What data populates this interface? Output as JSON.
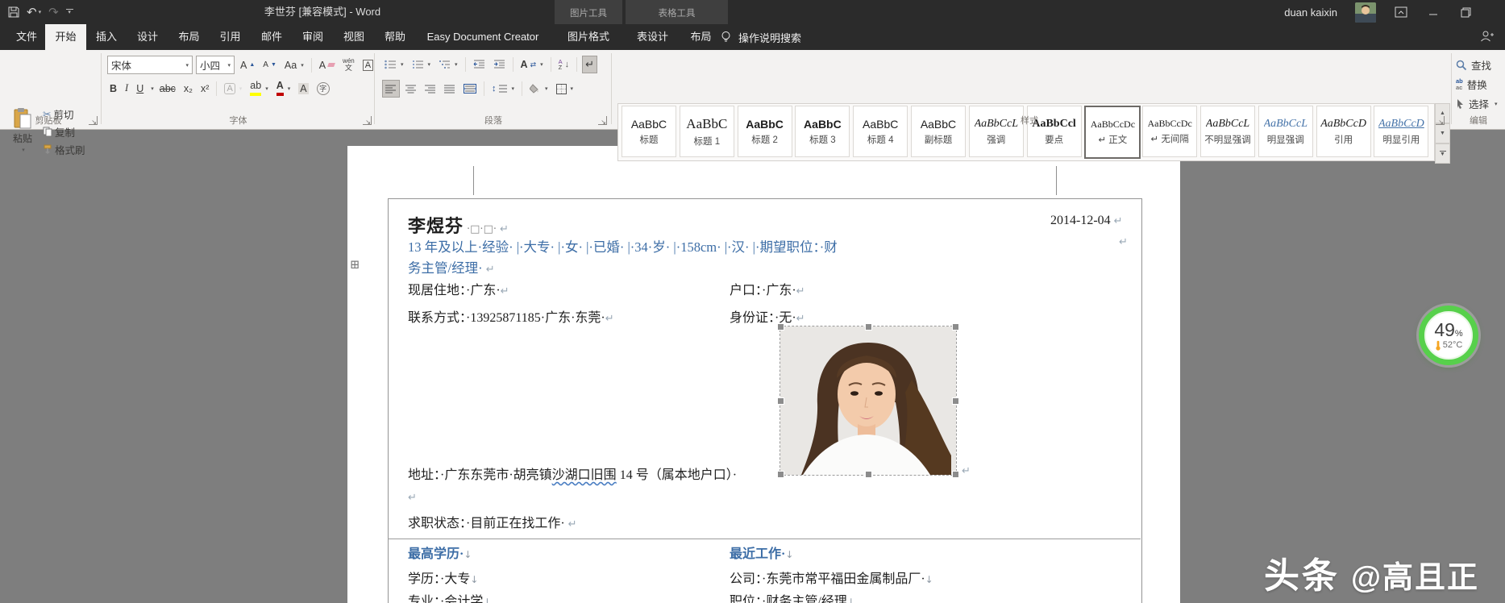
{
  "title_bar": {
    "title": "李世芬 [兼容模式]  -  Word",
    "user_name": "duan kaixin",
    "contextual_groups": [
      {
        "label": "图片工具"
      },
      {
        "label": "表格工具"
      }
    ]
  },
  "tabs": {
    "items": [
      {
        "id": "file",
        "label": "文件"
      },
      {
        "id": "home",
        "label": "开始",
        "active": true
      },
      {
        "id": "insert",
        "label": "插入"
      },
      {
        "id": "design",
        "label": "设计"
      },
      {
        "id": "layout",
        "label": "布局"
      },
      {
        "id": "references",
        "label": "引用"
      },
      {
        "id": "mailings",
        "label": "邮件"
      },
      {
        "id": "review",
        "label": "审阅"
      },
      {
        "id": "view",
        "label": "视图"
      },
      {
        "id": "help",
        "label": "帮助"
      },
      {
        "id": "easy-document-creator",
        "label": "Easy Document Creator"
      },
      {
        "id": "picture-format",
        "label": "图片格式",
        "contextual": true
      },
      {
        "id": "table-design",
        "label": "表设计",
        "contextual": true
      },
      {
        "id": "table-layout",
        "label": "布局",
        "contextual": true
      }
    ],
    "tell_me": "操作说明搜索"
  },
  "ribbon": {
    "clipboard": {
      "label": "剪贴板",
      "paste": "粘贴",
      "cut": "剪切",
      "copy": "复制",
      "format_painter": "格式刷"
    },
    "font": {
      "label": "字体",
      "font_name": "宋体",
      "font_size": "小四",
      "bold": "B",
      "italic": "I",
      "underline": "U",
      "strike": "abc",
      "subscript": "x₂",
      "superscript": "x²",
      "grow": "A",
      "shrink": "A",
      "change_case": "Aa",
      "clear": "A",
      "phonetic_top": "wén",
      "phonetic_bottom": "文",
      "char_border": "A",
      "text_effects": "A",
      "highlight": "ab",
      "font_color": "A",
      "char_shading": "A",
      "enclose": "字"
    },
    "paragraph": {
      "label": "段落",
      "cjk_layout": "A",
      "sort_a": "A",
      "sort_z": "Z"
    },
    "styles": {
      "label": "样式",
      "items": [
        {
          "preview": "AaBbC",
          "name": "标题"
        },
        {
          "preview": "AaBbC",
          "name": "标题 1",
          "serif": true,
          "lg": true
        },
        {
          "preview": "AaBbC",
          "name": "标题 2",
          "bold": true
        },
        {
          "preview": "AaBbC",
          "name": "标题 3",
          "bold": true
        },
        {
          "preview": "AaBbC",
          "name": "标题 4"
        },
        {
          "preview": "AaBbC",
          "name": "副标题"
        },
        {
          "preview": "AaBbCcL",
          "name": "强调",
          "serif": true,
          "italic": true
        },
        {
          "preview": "AaBbCcl",
          "name": "要点",
          "serif": true,
          "bold": true
        },
        {
          "preview": "AaBbCcDc",
          "name": "↵ 正文",
          "serif": true,
          "sm": true,
          "selected": true
        },
        {
          "preview": "AaBbCcDc",
          "name": "↵ 无间隔",
          "serif": true,
          "sm": true
        },
        {
          "preview": "AaBbCcL",
          "name": "不明显强调",
          "serif": true,
          "italic": true
        },
        {
          "preview": "AaBbCcL",
          "name": "明显强调",
          "serif": true,
          "italic": true,
          "blue": true
        },
        {
          "preview": "AaBbCcD",
          "name": "引用",
          "serif": true,
          "italic": true
        },
        {
          "preview": "AaBbCcD",
          "name": "明显引用",
          "serif": true,
          "italic": true,
          "blue": true,
          "underline": true
        }
      ]
    },
    "editing": {
      "label": "编辑",
      "find": "查找",
      "replace": "替换",
      "select": "选择",
      "replace_ico_top": "ab",
      "replace_ico_bottom": "ac"
    }
  },
  "document": {
    "date": "2014-12-04",
    "name": "李煜芬",
    "name_marks": "·□·□·",
    "summary_line1": "13 年及以上·经验· |·大专· |·女· |·已婚· |·34·岁· |·158cm· |·汉· |·期望职位：·财",
    "summary_line2": "务主管/经理·",
    "info_rows": [
      {
        "left": "现居住地：·广东·",
        "right": "户口：·广东·"
      },
      {
        "left": "联系方式：·13925871185·广东·东莞·",
        "right": "身份证：·无·"
      }
    ],
    "address": {
      "prefix": "地址：·广东东莞市·胡亮镇",
      "wavy": "沙湖口旧围",
      "suffix": " 14 号（属本地户口）·"
    },
    "job_status": "求职状态：·目前正在找工作·",
    "sections": {
      "left": {
        "header": "最高学历·",
        "rows": [
          "学历：·大专",
          "专业：·会计学"
        ]
      },
      "right": {
        "header": "最近工作·",
        "rows": [
          "公司：·东莞市常平福田金属制品厂·",
          "职位：·财务主管/经理"
        ]
      }
    }
  },
  "overlay_widget": {
    "percent": "49",
    "unit": "%",
    "temperature": "52°C"
  },
  "watermark": {
    "brand": "头条",
    "handle": "@高且正"
  },
  "icons": {
    "pilcrow": "↵",
    "down_mark": "↓",
    "undo": "↶",
    "redo": "↷",
    "cut_glyph": "✂",
    "caret": "▾",
    "paragraph_mark": "↵",
    "updown": "↕",
    "table_handle": "⊞",
    "borders_glyph": "⊞",
    "bulb": "💡"
  }
}
